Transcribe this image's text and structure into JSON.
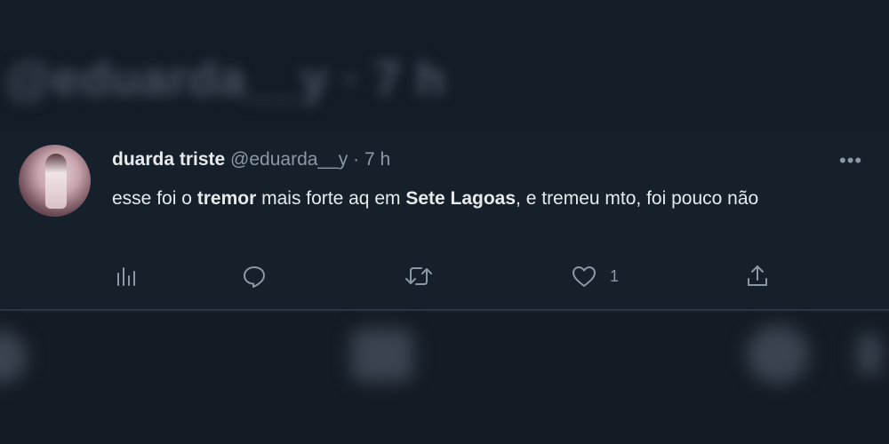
{
  "tweet": {
    "author_name": "duarda triste",
    "author_handle": "@eduarda__y",
    "separator": "·",
    "timestamp": "7 h",
    "body": {
      "part1": "esse foi o ",
      "bold1": "tremor",
      "part2": " mais forte aq em ",
      "bold2": "Sete Lagoas",
      "part3": ", e tremeu mto, foi pouco não"
    },
    "more_label": "•••"
  },
  "actions": {
    "analytics_icon": "bar-chart-icon",
    "reply_icon": "speech-bubble-icon",
    "retweet_icon": "retweet-icon",
    "like_icon": "heart-icon",
    "like_count": "1",
    "share_icon": "share-upload-icon"
  },
  "background_blurred": {
    "handle_text": "@eduarda__y · 7 h"
  },
  "colors": {
    "background": "#15202b",
    "text_primary": "#e7e9ea",
    "text_secondary": "#8b98a5",
    "divider": "#2a3643"
  }
}
